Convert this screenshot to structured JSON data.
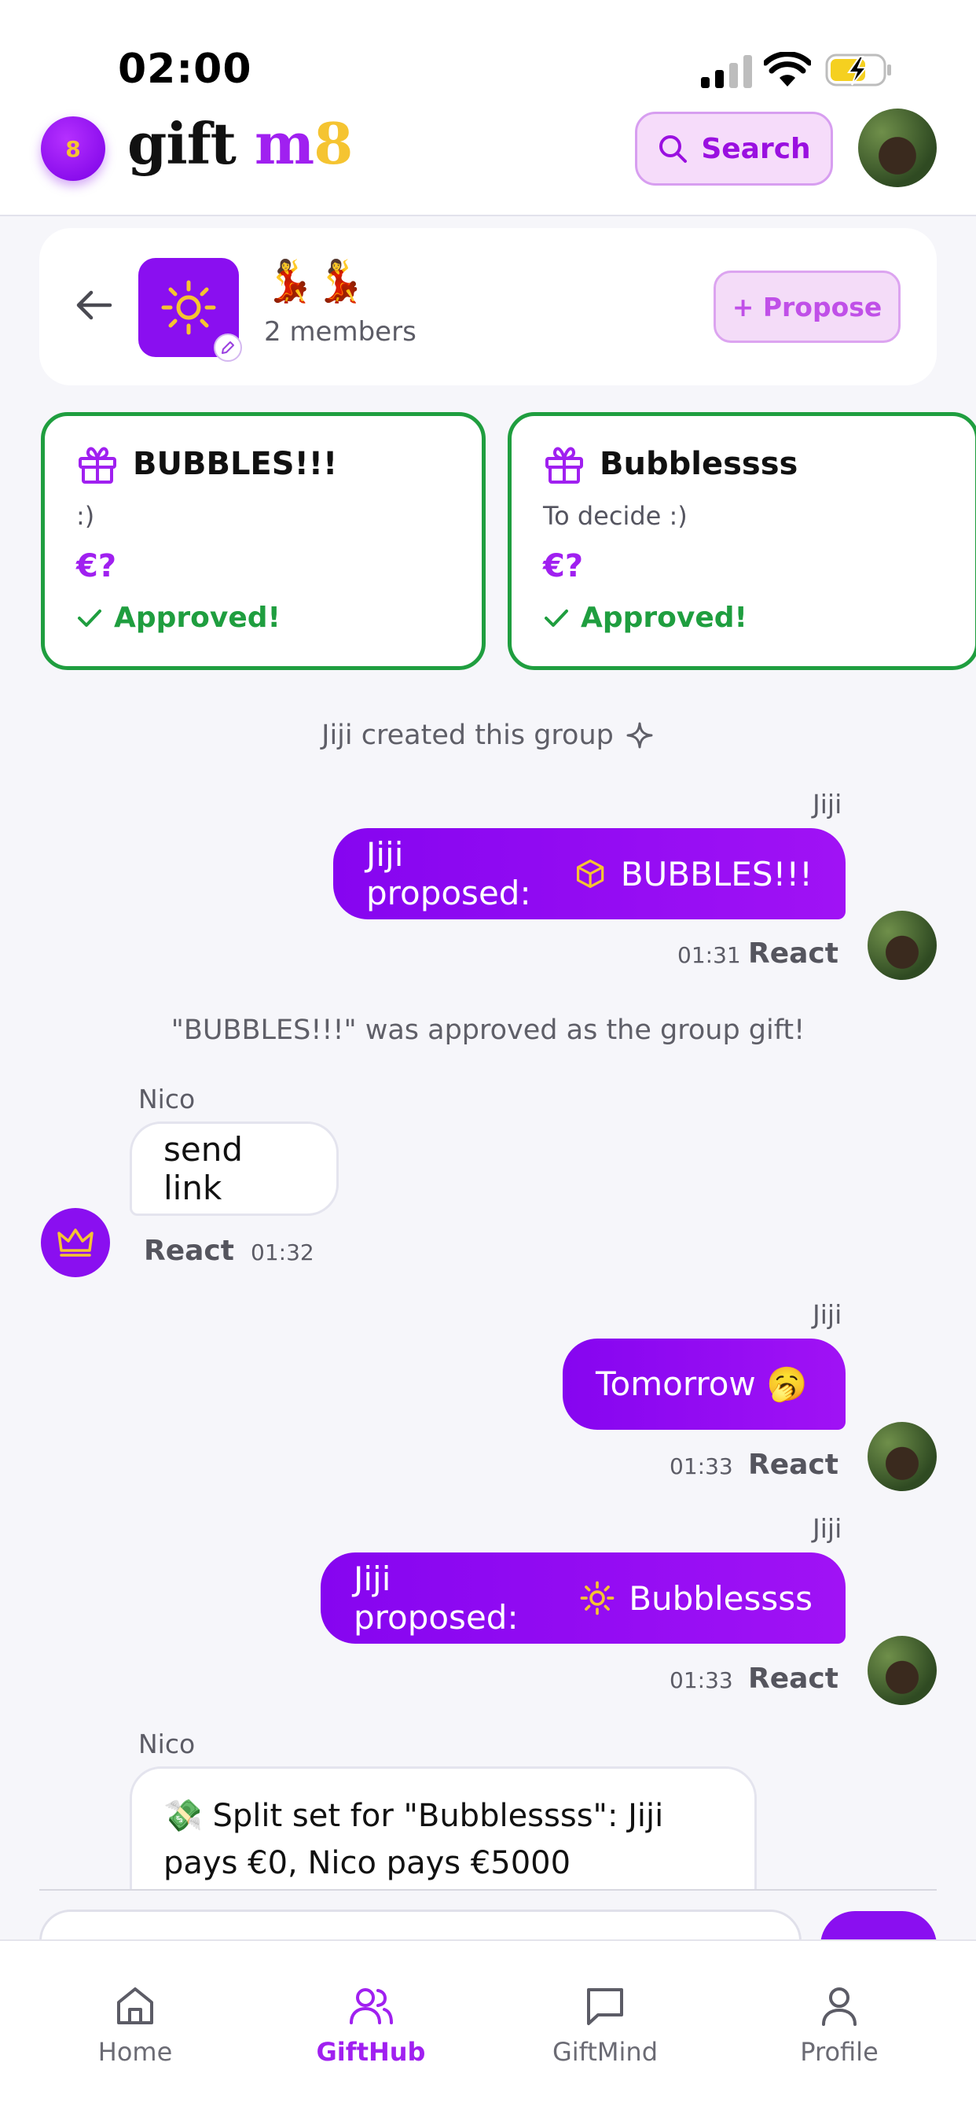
{
  "status_bar": {
    "time": "02:00"
  },
  "header": {
    "logo_badge": "8",
    "brand": {
      "part1": "gift ",
      "part2": "m",
      "part3": "8"
    },
    "search_label": "Search"
  },
  "group": {
    "member_emojis": "💃💃",
    "member_count": "2 members",
    "propose_label": "+ Propose"
  },
  "gifts": [
    {
      "title": "BUBBLES!!!",
      "description": ":)",
      "price": "€?",
      "status": "Approved!"
    },
    {
      "title": "Bubblessss",
      "description": "To decide :)",
      "price": "€?",
      "status": "Approved!"
    }
  ],
  "chat": {
    "created": "Jiji created this group",
    "messages": [
      {
        "sender": "Jiji",
        "prefix": "Jiji proposed:",
        "item": "BUBBLES!!!",
        "time": "01:31",
        "react": "React"
      },
      {
        "system": "\"BUBBLES!!!\" was approved as the group gift!"
      },
      {
        "sender": "Nico",
        "text": "send link",
        "time": "01:32",
        "react": "React"
      },
      {
        "sender": "Jiji",
        "text": "Tomorrow 🥱",
        "time": "01:33",
        "react": "React"
      },
      {
        "sender": "Jiji",
        "prefix": "Jiji proposed:",
        "item": "Bubblessss",
        "time": "01:33",
        "react": "React"
      },
      {
        "sender": "Nico",
        "line1": "💸 Split set for \"Bubblessss\": Jiji",
        "line2": "pays €0, Nico pays €5000"
      }
    ]
  },
  "nav": [
    {
      "label": "Home",
      "icon": "home-icon"
    },
    {
      "label": "GiftHub",
      "icon": "users-icon",
      "active": true
    },
    {
      "label": "GiftMind",
      "icon": "chat-icon"
    },
    {
      "label": "Profile",
      "icon": "user-icon"
    }
  ],
  "colors": {
    "accent": "#a020f0",
    "approved": "#1f9e3f",
    "gold": "#f5c431"
  }
}
